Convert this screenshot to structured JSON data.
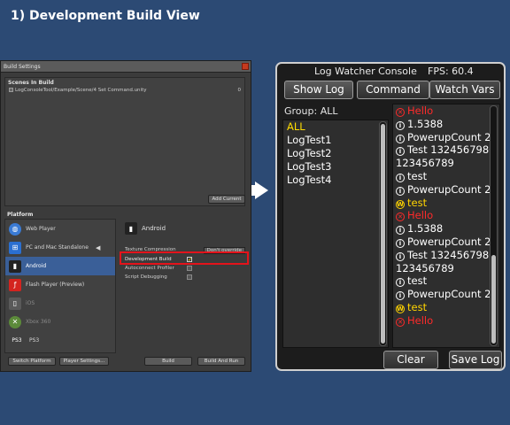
{
  "slide": {
    "title": "1) Development Build View"
  },
  "build_settings": {
    "window_title": "Build Settings",
    "scenes_header": "Scenes In Build",
    "scene_path": "LogConsoleTool/Example/Scene/4 Set Command.unity",
    "scene_index": "0",
    "add_current": "Add Current",
    "platform_label": "Platform",
    "platforms": [
      {
        "label": "Web Player",
        "icon": "globe-icon"
      },
      {
        "label": "PC and Mac Standalone",
        "icon": "windows-icon"
      },
      {
        "label": "Android",
        "icon": "android-icon",
        "selected": true
      },
      {
        "label": "Flash Player (Preview)",
        "icon": "flash-icon"
      },
      {
        "label": "iOS",
        "icon": "ios-icon"
      },
      {
        "label": "Xbox 360",
        "icon": "xbox-icon"
      },
      {
        "label": "PS3",
        "icon": "ps3-icon"
      }
    ],
    "selected_platform": "Android",
    "texture_compression_label": "Texture Compression",
    "texture_compression_value": "Don't override",
    "development_build_label": "Development Build",
    "autoconnect_profiler_label": "Autoconnect Profiler",
    "script_debugging_label": "Script Debugging",
    "switch_platform": "Switch Platform",
    "player_settings": "Player Settings...",
    "build": "Build",
    "build_and_run": "Build And Run"
  },
  "console": {
    "title": "Log Watcher Console",
    "fps": "FPS: 60.4",
    "buttons": {
      "show_log": "Show Log",
      "command": "Command",
      "watch_vars": "Watch Vars"
    },
    "group_label": "Group: ALL",
    "groups": [
      "ALL",
      "LogTest1",
      "LogTest2",
      "LogTest3",
      "LogTest4"
    ],
    "logs": [
      {
        "type": "error",
        "text": "Hello"
      },
      {
        "type": "info",
        "text": "1.5388"
      },
      {
        "type": "info",
        "text": "PowerupCount 23"
      },
      {
        "type": "info",
        "text": "Test 1324567980123456789"
      },
      {
        "type": "info",
        "text": "test"
      },
      {
        "type": "info",
        "text": "PowerupCount 23"
      },
      {
        "type": "warn",
        "text": "test"
      },
      {
        "type": "error",
        "text": "Hello"
      },
      {
        "type": "info",
        "text": "1.5388"
      },
      {
        "type": "info",
        "text": "PowerupCount 23"
      },
      {
        "type": "info",
        "text": "Test 1324567980123456789"
      },
      {
        "type": "info",
        "text": "test"
      },
      {
        "type": "info",
        "text": "PowerupCount 23"
      },
      {
        "type": "warn",
        "text": "test"
      },
      {
        "type": "error",
        "text": "Hello"
      }
    ],
    "footer": {
      "clear": "Clear",
      "save_log": "Save Log"
    }
  }
}
